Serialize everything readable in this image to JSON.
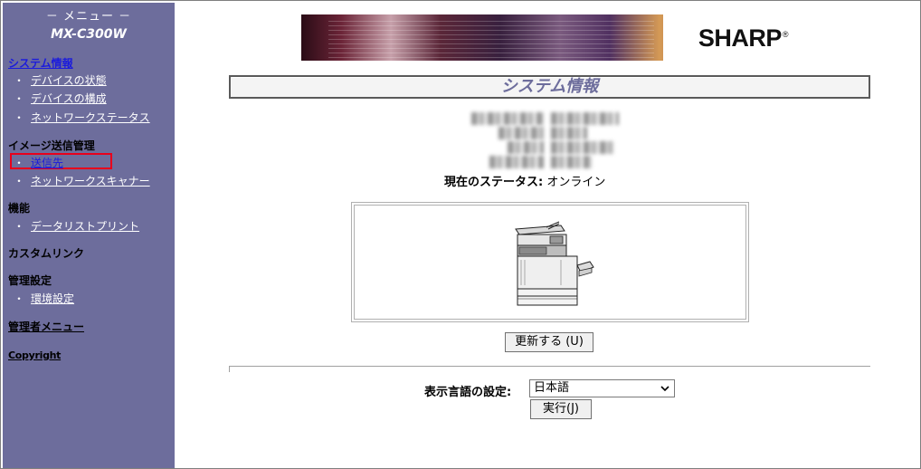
{
  "sidebar": {
    "menu_heading": "－ メニュー －",
    "model": "MX-C300W",
    "sections": [
      {
        "title": "システム情報",
        "items": [
          "デバイスの状態",
          "デバイスの構成",
          "ネットワークステータス"
        ]
      },
      {
        "title": "イメージ送信管理",
        "items": [
          "送信先",
          "ネットワークスキャナー"
        ]
      },
      {
        "title": "機能",
        "items": [
          "データリストプリント"
        ]
      },
      {
        "title": "カスタムリンク",
        "items": []
      },
      {
        "title": "管理設定",
        "items": [
          "環境設定"
        ]
      },
      {
        "title": "管理者メニュー",
        "items": []
      }
    ],
    "bullet": "・",
    "copyright": "Copyright",
    "active_item": "送信先",
    "highlight_color": "#e8001c",
    "sidebar_color": "#6d6d9c",
    "link_color": "#1b1bdc"
  },
  "banner": {
    "brand": "SHARP",
    "reg": "®"
  },
  "main": {
    "title": "システム情報",
    "status_label": "現在のステータス:",
    "status_value": "オンライン",
    "device_image": "multifunction-printer-icon",
    "refresh_button": "更新する (U)",
    "language_label": "表示言語の設定:",
    "language_value": "日本語",
    "run_button": "実行(J)"
  }
}
